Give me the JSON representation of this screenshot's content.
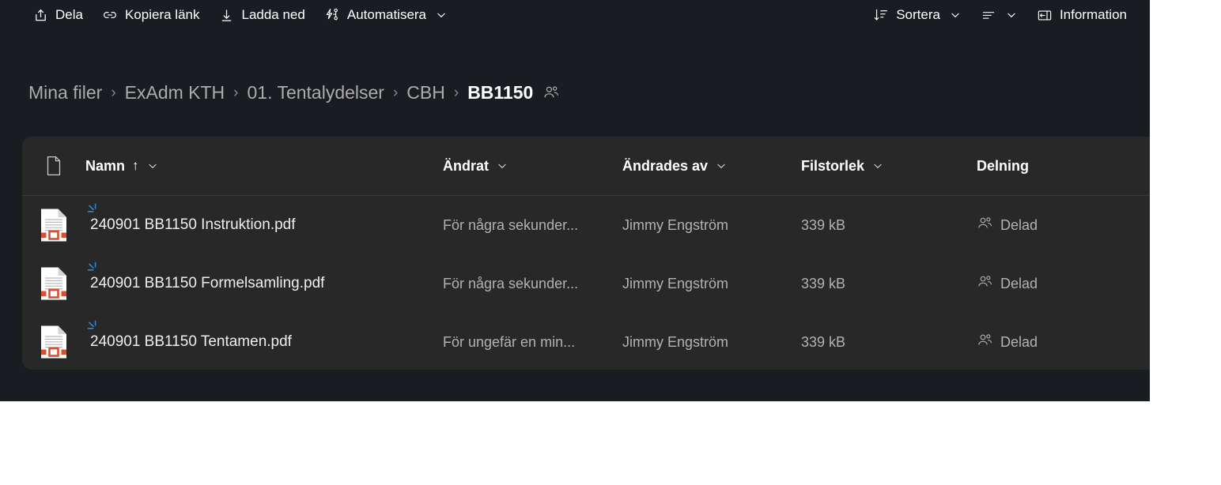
{
  "toolbar": {
    "left_items": [
      {
        "label": "Dela",
        "icon": "share-icon",
        "has_chevron": false
      },
      {
        "label": "Kopiera länk",
        "icon": "link-icon",
        "has_chevron": false
      },
      {
        "label": "Ladda ned",
        "icon": "download-icon",
        "has_chevron": false
      },
      {
        "label": "Automatisera",
        "icon": "automate-bolt-icon",
        "has_chevron": true
      }
    ],
    "right_items": [
      {
        "label": "Sortera",
        "icon": "sort-icon",
        "has_chevron": true
      },
      {
        "label": "",
        "icon": "view-list-icon",
        "has_chevron": true
      },
      {
        "label": "Information",
        "icon": "info-panel-icon",
        "has_chevron": false
      }
    ]
  },
  "breadcrumb": {
    "separator": "›",
    "items": [
      {
        "label": "Mina filer",
        "current": false
      },
      {
        "label": "ExAdm KTH",
        "current": false
      },
      {
        "label": "01. Tentalydelser",
        "current": false
      },
      {
        "label": "CBH",
        "current": false
      },
      {
        "label": "BB1150",
        "current": true
      }
    ],
    "shared_icon": "people-icon"
  },
  "file_list": {
    "columns": [
      {
        "key": "icon",
        "label": "",
        "icon": "document-icon",
        "has_chevron": false,
        "sort": ""
      },
      {
        "key": "name",
        "label": "Namn",
        "has_chevron": true,
        "sort": "↑"
      },
      {
        "key": "mod",
        "label": "Ändrat",
        "has_chevron": true,
        "sort": ""
      },
      {
        "key": "by",
        "label": "Ändrades av",
        "has_chevron": true,
        "sort": ""
      },
      {
        "key": "size",
        "label": "Filstorlek",
        "has_chevron": true,
        "sort": ""
      },
      {
        "key": "share",
        "label": "Delning",
        "has_chevron": false,
        "sort": ""
      }
    ],
    "rows": [
      {
        "icon": "pdf-file-icon",
        "new_badge": true,
        "name": "240901 BB1150 Instruktion.pdf",
        "modified": "För några sekunder...",
        "modified_by": "Jimmy Engström",
        "size": "339 kB",
        "sharing": "Delad",
        "sharing_icon": "people-icon"
      },
      {
        "icon": "pdf-file-icon",
        "new_badge": true,
        "name": "240901 BB1150 Formelsamling.pdf",
        "modified": "För några sekunder...",
        "modified_by": "Jimmy Engström",
        "size": "339 kB",
        "sharing": "Delad",
        "sharing_icon": "people-icon"
      },
      {
        "icon": "pdf-file-icon",
        "new_badge": true,
        "name": "240901 BB1150 Tentamen.pdf",
        "modified": "För ungefär en min...",
        "modified_by": "Jimmy Engström",
        "size": "339 kB",
        "sharing": "Delad",
        "sharing_icon": "people-icon"
      }
    ]
  },
  "colors": {
    "background": "#191c21",
    "panel": "#282828",
    "text_primary": "#ffffff",
    "text_secondary": "#b3b2b0",
    "pdf_accent": "#d85030",
    "new_badge": "#2b88d8"
  }
}
